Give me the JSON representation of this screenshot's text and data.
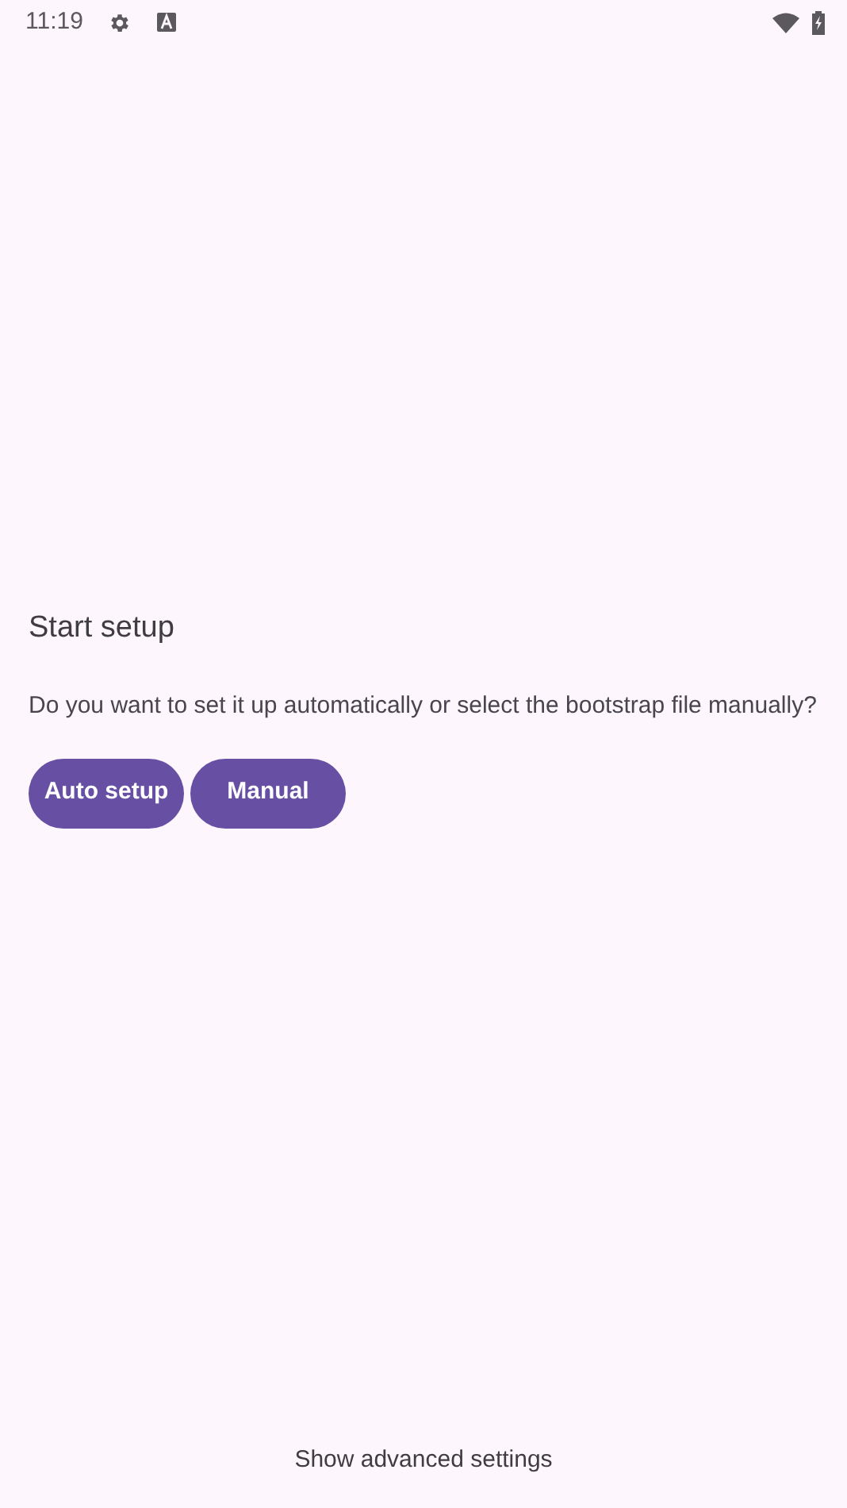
{
  "status_bar": {
    "time": "11:19"
  },
  "title": "Start setup",
  "message": "Do you want to set it up automatically or select the bootstrap file manually?",
  "buttons": [
    {
      "label": "Auto setup"
    },
    {
      "label": "Manual"
    }
  ],
  "footer_link": "Show advanced settings"
}
